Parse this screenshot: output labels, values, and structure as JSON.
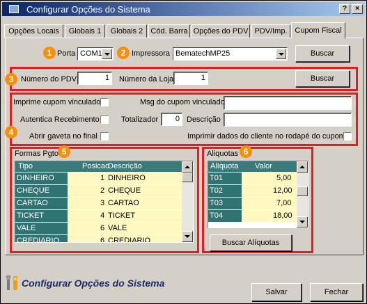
{
  "window": {
    "title": "Configurar Opções do Sistema"
  },
  "tabs": [
    "Opções Locais",
    "Globais 1",
    "Globais 2",
    "Cód. Barra",
    "Opções do PDV",
    "PDV/Imp.",
    "Cupom Fiscal"
  ],
  "badges": [
    "1",
    "2",
    "3",
    "4",
    "5",
    "6"
  ],
  "section1": {
    "porta_label": "Porta",
    "porta_value": "COM1",
    "impressora_label": "Impressora",
    "impressora_value": "BematechMP25",
    "buscar": "Buscar"
  },
  "section3": {
    "pdv_label": "Número do PDV",
    "pdv_value": "1",
    "loja_label": "Número da Loja",
    "loja_value": "1",
    "buscar": "Buscar"
  },
  "section4": {
    "imprime_vinc": "Imprime cupom vinculado",
    "msg_label": "Msg do cupom vinculado",
    "msg_value": "",
    "autentica": "Autentica Recebimento",
    "totalizador_label": "Totalizador",
    "totalizador_value": "0",
    "descricao_label": "Descrição",
    "descricao_value": "",
    "abrir_gaveta": "Abrir gaveta no final",
    "imprimir_dados": "Imprimir dados do cliente no rodapé do cupom"
  },
  "formas": {
    "title": "Formas Pgto",
    "columns": [
      "Tipo",
      "Posicao",
      "Descrição"
    ],
    "rows": [
      {
        "tipo": "DINHEIRO",
        "posicao": "1",
        "descricao": "DINHEIRO"
      },
      {
        "tipo": "CHEQUE",
        "posicao": "2",
        "descricao": "CHEQUE"
      },
      {
        "tipo": "CARTAO",
        "posicao": "3",
        "descricao": "CARTAO"
      },
      {
        "tipo": "TICKET",
        "posicao": "4",
        "descricao": "TICKET"
      },
      {
        "tipo": "VALE",
        "posicao": "6",
        "descricao": "VALE"
      },
      {
        "tipo": "CREDIARIO",
        "posicao": "6",
        "descricao": "CREDIARIO"
      }
    ]
  },
  "aliquotas": {
    "title": "Aliquotas",
    "columns": [
      "Alíquota",
      "Valor"
    ],
    "rows": [
      {
        "aliquota": "T01",
        "valor": "5,00"
      },
      {
        "aliquota": "T02",
        "valor": "12,00"
      },
      {
        "aliquota": "T03",
        "valor": "7,00"
      },
      {
        "aliquota": "T04",
        "valor": "18,00"
      }
    ],
    "buscar": "Buscar Alíquotas"
  },
  "footer": {
    "title": "Configurar Opções do Sistema",
    "salvar": "Salvar",
    "fechar": "Fechar"
  }
}
